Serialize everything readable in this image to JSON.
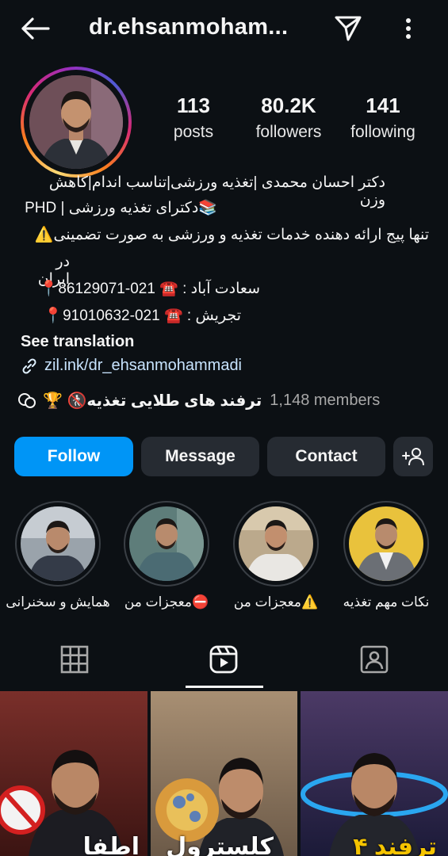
{
  "header": {
    "username": "dr.ehsanmoham...",
    "back_icon": "arrow-left-icon",
    "send_icon": "paper-plane-icon",
    "more_icon": "vertical-ellipsis-icon"
  },
  "stats": {
    "posts_count": "113",
    "posts_label": "posts",
    "followers_count": "80.2K",
    "followers_label": "followers",
    "following_count": "141",
    "following_label": "following"
  },
  "bio": {
    "line1": "دکتر احسان محمدی |تغذیه ورزشی|تناسب اندام|کاهش وزن",
    "line2": "PHD | دکترای تغذیه ورزشی📚",
    "line3": "تنها پیج ارائه دهنده خدمات تغذیه و ورزشی به صورت تضمینی⚠️",
    "line4": "در ایران",
    "line5": "سعادت آباد : ☎️ 021-86129071📍",
    "line6": "تجریش : ☎️ 021-91010632📍",
    "see_translation": "See translation",
    "link": "zil.ink/dr_ehsanmohammadi",
    "channel_name": "ترفند های طلایی تغذیه🚷 🏆",
    "channel_members": "1,148 members"
  },
  "actions": {
    "follow": "Follow",
    "message": "Message",
    "contact": "Contact",
    "add_user_icon": "add-person-icon"
  },
  "highlights": [
    {
      "label": "همایش و سخنرانی"
    },
    {
      "label": "⛔معجزات من"
    },
    {
      "label": "⚠️معجزات من"
    },
    {
      "label": "نکات مهم تغذیه"
    }
  ],
  "tabs": [
    "grid-icon",
    "reels-icon",
    "tagged-icon"
  ],
  "posts": [
    {
      "caption": "اطفا"
    },
    {
      "caption": "کلسترول"
    },
    {
      "caption": "۴ ترفند"
    }
  ],
  "colors": {
    "background": "#0c1014",
    "follow_button": "#0095f6",
    "secondary_button": "#262b32",
    "link": "#c8e4ff"
  }
}
